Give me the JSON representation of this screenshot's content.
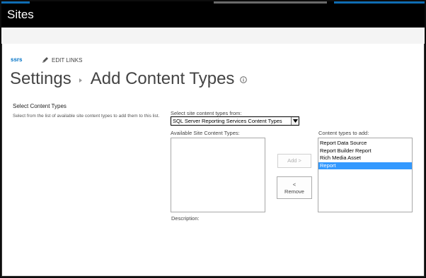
{
  "app": {
    "title": "Sites"
  },
  "colors": {
    "topbar": "#000000",
    "link": "#0072c6",
    "selected": "#3399ff"
  },
  "breadcrumb": {
    "site": "ssrs",
    "edit_links": "EDIT LINKS"
  },
  "page": {
    "title_part1": "Settings",
    "title_part2": "Add Content Types"
  },
  "section": {
    "title": "Select Content Types",
    "description": "Select from the list of available site content types to add them to this list."
  },
  "form": {
    "select_from_label": "Select site content types from:",
    "select_from_value": "SQL Server Reporting Services Content Types",
    "available_label": "Available Site Content Types:",
    "available_items": [],
    "to_add_label": "Content types to add:",
    "to_add_items": [
      {
        "label": "Report Data Source",
        "selected": false
      },
      {
        "label": "Report Builder Report",
        "selected": false
      },
      {
        "label": "Rich Media Asset",
        "selected": false
      },
      {
        "label": "Report",
        "selected": true
      }
    ],
    "add_button": "Add >",
    "remove_button_line1": "<",
    "remove_button_line2": "Remove",
    "description_label": "Description:"
  },
  "icons": {
    "pencil": "pencil-icon",
    "info": "info-icon",
    "dropdown": "chevron-down-icon"
  }
}
